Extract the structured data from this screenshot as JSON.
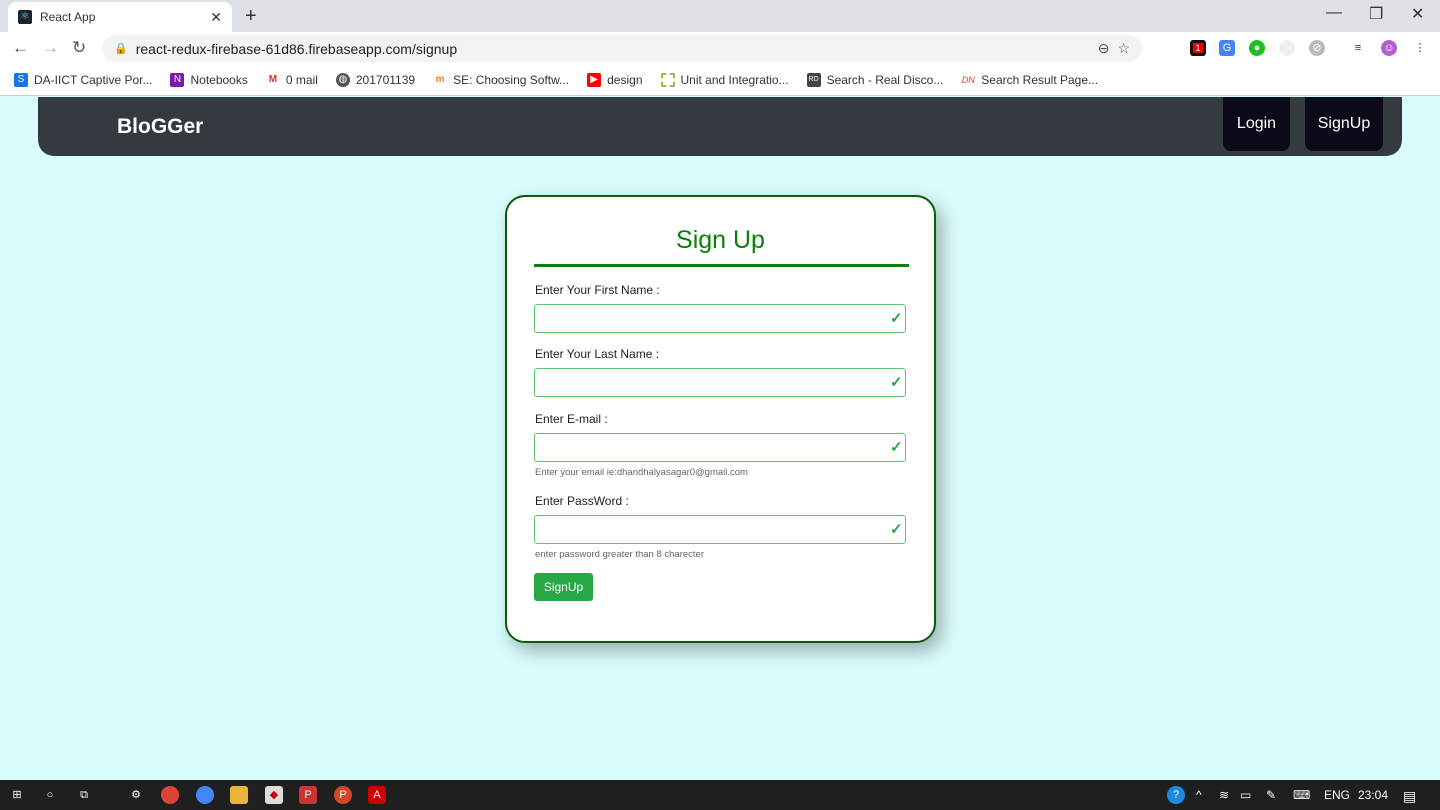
{
  "browser": {
    "tab_title": "React App",
    "url": "react-redux-firebase-61d86.firebaseapp.com/signup",
    "bookmarks": [
      {
        "label": "DA-IICT Captive Por...",
        "icon": "s-icon",
        "color": "#1a73e8"
      },
      {
        "label": "Notebooks",
        "icon": "onenote-icon",
        "color": "#7719aa"
      },
      {
        "label": "0 mail",
        "icon": "gmail-icon",
        "color": "#d93025"
      },
      {
        "label": "201701139",
        "icon": "globe-icon",
        "color": "#555555"
      },
      {
        "label": "SE: Choosing Softw...",
        "icon": "moodle-icon",
        "color": "#f98012"
      },
      {
        "label": "design",
        "icon": "youtube-icon",
        "color": "#ff0000"
      },
      {
        "label": "Unit and Integratio...",
        "icon": "dashed-square-icon",
        "color": "#8bc34a"
      },
      {
        "label": "Search - Real Disco...",
        "icon": "rd-icon",
        "color": "#444444"
      },
      {
        "label": "Search Result Page...",
        "icon": "dn-icon",
        "color": "#e53935"
      }
    ],
    "extension_badge": "1"
  },
  "app": {
    "brand": "BloGGer",
    "nav": {
      "login": "Login",
      "signup": "SignUp"
    }
  },
  "form": {
    "title": "Sign Up",
    "fields": [
      {
        "label": "Enter Your First Name :",
        "value": "",
        "help": ""
      },
      {
        "label": "Enter Your Last Name :",
        "value": "",
        "help": ""
      },
      {
        "label": "Enter E-mail :",
        "value": "",
        "help": "Enter your email ie:dhandhalyasagar0@gmail.com"
      },
      {
        "label": "Enter PassWord :",
        "value": "",
        "help": "enter password greater than 8 charecter"
      }
    ],
    "submit": "SignUp",
    "accent": "#28a745"
  },
  "taskbar": {
    "lang": "ENG",
    "time": "23:04"
  }
}
